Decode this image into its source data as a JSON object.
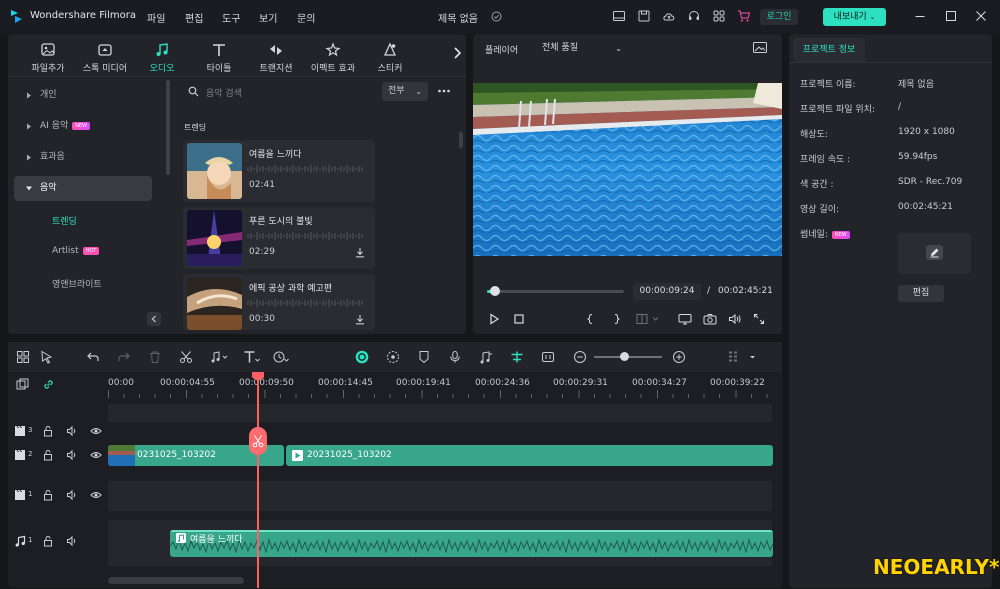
{
  "app": {
    "title": "Wondershare Filmora",
    "project_title": "제목 없음"
  },
  "menu": [
    "파일",
    "편집",
    "도구",
    "보기",
    "문의"
  ],
  "header": {
    "login_label": "로그인",
    "export_label": "내보내기"
  },
  "media_tabs": [
    {
      "label": "파일추가",
      "icon": "media-icon"
    },
    {
      "label": "스톡 미디어",
      "icon": "stock-media-icon"
    },
    {
      "label": "오디오",
      "icon": "music-note-icon",
      "active": true
    },
    {
      "label": "타이틀",
      "icon": "title-text-icon"
    },
    {
      "label": "트랜지션",
      "icon": "transition-icon"
    },
    {
      "label": "이펙트 효과",
      "icon": "effects-icon"
    },
    {
      "label": "스티커",
      "icon": "sticker-icon"
    }
  ],
  "sidebar": {
    "items": [
      {
        "label": "개인"
      },
      {
        "label": "AI 음악",
        "badge": "NEW"
      },
      {
        "label": "효과음"
      },
      {
        "label": "음악",
        "active": true
      }
    ],
    "sub_items": [
      {
        "label": "트렌딩",
        "active": true
      },
      {
        "label": "Artlist",
        "badge": "HOT"
      },
      {
        "label": "영앤브라이트"
      }
    ]
  },
  "search": {
    "placeholder": "음악 검색",
    "filter_value": "전부"
  },
  "music_list": {
    "section_title": "트렌딩",
    "items": [
      {
        "title": "여름을 느끼다",
        "duration": "02:41"
      },
      {
        "title": "푸른 도시의 불빛",
        "duration": "02:29"
      },
      {
        "title": "에픽 공상 과학 예고편",
        "duration": "00:30"
      }
    ]
  },
  "player": {
    "label": "플레이어",
    "quality": "전체 품질",
    "current_time": "00:00:09:24",
    "separator": "/",
    "total_time": "00:02:45:21",
    "progress": 0.06
  },
  "project_info": {
    "tab_label": "프로젝트 정보",
    "rows": [
      {
        "label": "프로젝트 이름:",
        "value": "제목 없음"
      },
      {
        "label": "프로젝트 파일 위치:",
        "value": "/"
      },
      {
        "label": "해상도:",
        "value": "1920 x 1080"
      },
      {
        "label": "프레임 속도 :",
        "value": "59.94fps"
      },
      {
        "label": "색 공간 :",
        "value": "SDR - Rec.709"
      },
      {
        "label": "영상 길이:",
        "value": "00:02:45:21"
      }
    ],
    "thumbnail_label": "썸네일:",
    "thumbnail_badge": "NEW",
    "edit_label": "편집"
  },
  "timeline": {
    "ruler": [
      "00:00",
      "00:00:04:55",
      "00:00:09:50",
      "00:00:14:45",
      "00:00:19:41",
      "00:00:24:36",
      "00:00:29:31",
      "00:00:34:27",
      "00:00:39:22"
    ],
    "tracks": [
      {
        "type": "video",
        "number": "3"
      },
      {
        "type": "video",
        "number": "2"
      },
      {
        "type": "video",
        "number": "1"
      },
      {
        "type": "audio",
        "number": "1"
      }
    ],
    "clips": {
      "video_clip_a": "0231025_103202",
      "video_clip_b": "20231025_103202",
      "audio_clip": "여름을 느끼다"
    }
  },
  "watermark": "NEOEARLY*",
  "colors": {
    "accent": "#2de0c0",
    "playhead": "#ff5f62",
    "clip": "#37a68b",
    "panel": "#22242a"
  }
}
